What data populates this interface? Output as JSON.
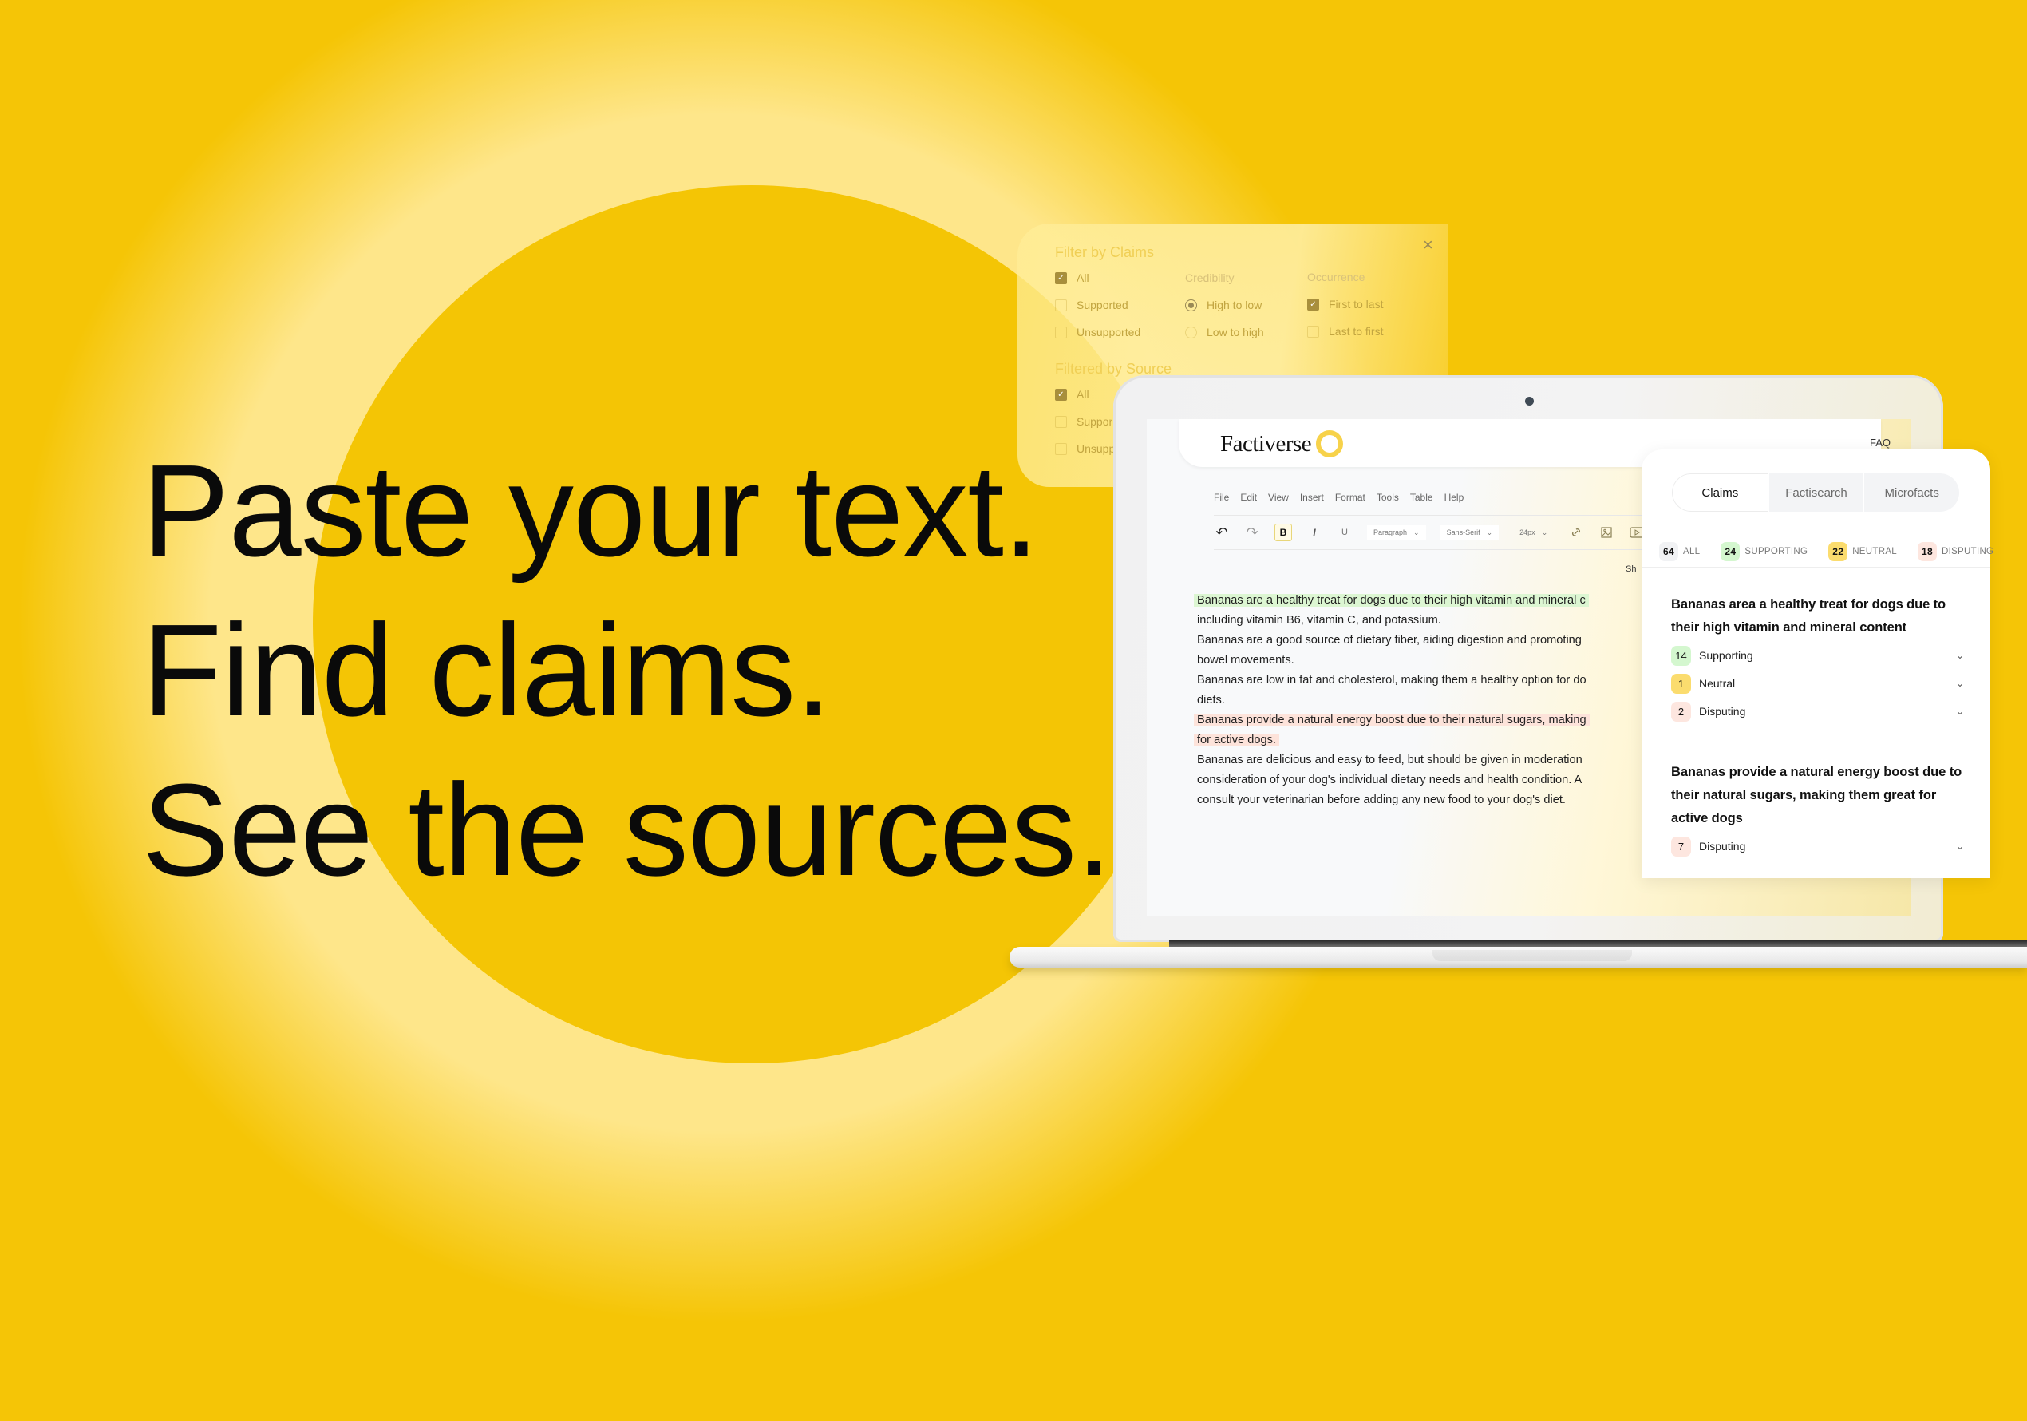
{
  "headline": {
    "line1": "Paste your text.",
    "line2": "Find claims.",
    "line3": "See the sources."
  },
  "filter_panel": {
    "title_claims": "Filter by Claims",
    "claims_options": [
      {
        "label": "All",
        "checked": true
      },
      {
        "label": "Supported",
        "checked": false
      },
      {
        "label": "Unsupported",
        "checked": false
      }
    ],
    "credibility_header": "Credibility",
    "credibility_options": [
      {
        "label": "High to low",
        "selected": true
      },
      {
        "label": "Low to high",
        "selected": false
      }
    ],
    "occurrence_header": "Occurrence",
    "occurrence_options": [
      {
        "label": "First to last",
        "checked": true
      },
      {
        "label": "Last to first",
        "checked": false
      }
    ],
    "title_source": "Filtered by Source",
    "source_options": [
      {
        "label": "All",
        "checked": true
      },
      {
        "label": "Suppor",
        "checked": false
      },
      {
        "label": "Unsupp",
        "checked": false
      }
    ],
    "close_icon": "×",
    "check_glyph": "✓"
  },
  "app": {
    "logo": "Factiverse",
    "faq": "FAQ",
    "menu": [
      "File",
      "Edit",
      "View",
      "Insert",
      "Format",
      "Tools",
      "Table",
      "Help"
    ],
    "toolbar": {
      "undo_icon": "↶",
      "redo_icon": "↷",
      "bold": "B",
      "italic": "I",
      "underline": "U",
      "paragraph": "Paragraph",
      "font": "Sans-Serif",
      "size": "24px",
      "chevron": "⌄"
    },
    "truncated_label": "Sh",
    "document": {
      "lines": [
        {
          "text": "Bananas are a healthy treat for dogs due to their high vitamin and mineral c",
          "highlight": "green"
        },
        {
          "text": "including vitamin B6, vitamin C, and potassium.",
          "highlight": "none"
        },
        {
          "text": "Bananas are a good source of dietary fiber, aiding digestion and promoting",
          "highlight": "none"
        },
        {
          "text": "bowel movements.",
          "highlight": "none"
        },
        {
          "text": "Bananas are low in fat and cholesterol, making them a healthy option for do",
          "highlight": "none"
        },
        {
          "text": "diets.",
          "highlight": "none"
        },
        {
          "text": "Bananas provide a natural energy boost due to their natural sugars, making",
          "highlight": "red"
        },
        {
          "text": "for active dogs.",
          "highlight": "red"
        },
        {
          "text": "Bananas are delicious and easy to feed, but should be given in moderation",
          "highlight": "none"
        },
        {
          "text": "consideration of your dog's individual dietary needs and health condition. A",
          "highlight": "none"
        },
        {
          "text": "consult your veterinarian before adding any new food to your dog's diet.",
          "highlight": "none"
        }
      ]
    }
  },
  "claims_panel": {
    "tabs": [
      {
        "label": "Claims",
        "active": true
      },
      {
        "label": "Factisearch",
        "active": false
      },
      {
        "label": "Microfacts",
        "active": false
      }
    ],
    "filters": [
      {
        "count": "64",
        "label": "ALL",
        "color": "#f1f2f4"
      },
      {
        "count": "24",
        "label": "SUPPORTING",
        "color": "#d4f7cf"
      },
      {
        "count": "22",
        "label": "NEUTRAL",
        "color": "#fbdc6e"
      },
      {
        "count": "18",
        "label": "DISPUTING",
        "color": "#fde6df"
      }
    ],
    "claims": [
      {
        "title": "Bananas area a healthy treat for dogs due to their high vitamin and mineral content",
        "stances": [
          {
            "count": "14",
            "label": "Supporting",
            "color": "#d4f7cf"
          },
          {
            "count": "1",
            "label": "Neutral",
            "color": "#fbdc6e"
          },
          {
            "count": "2",
            "label": "Disputing",
            "color": "#fde6df"
          }
        ]
      },
      {
        "title": "Bananas provide a natural energy boost due to their natural sugars, making them great for active dogs",
        "stances": [
          {
            "count": "7",
            "label": "Disputing",
            "color": "#fde6df"
          }
        ]
      }
    ],
    "chevron_icon": "⌄"
  },
  "colors": {
    "background": "#F5C506",
    "glow": "#FEE68A",
    "logo_ring": "#F7D24A"
  }
}
